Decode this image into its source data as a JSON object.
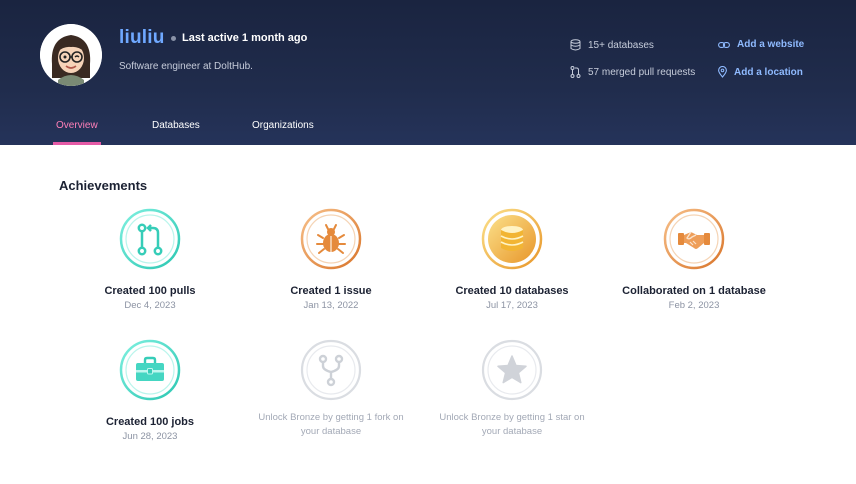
{
  "profile": {
    "username": "liuliu",
    "last_active": "Last active 1 month ago",
    "bio": "Software engineer at DoltHub."
  },
  "stats": {
    "databases": "15+ databases",
    "pulls": "57 merged pull requests",
    "website": "Add a website",
    "location": "Add a location"
  },
  "tabs": [
    "Overview",
    "Databases",
    "Organizations"
  ],
  "achievements_title": "Achievements",
  "achievements": [
    {
      "title": "Created 100 pulls",
      "date": "Dec 4, 2023"
    },
    {
      "title": "Created 1 issue",
      "date": "Jan 13, 2022"
    },
    {
      "title": "Created 10 databases",
      "date": "Jul 17, 2023"
    },
    {
      "title": "Collaborated on 1 database",
      "date": "Feb 2, 2023"
    },
    {
      "title": "Created 100 jobs",
      "date": "Jun 28, 2023"
    },
    {
      "locked_text": "Unlock Bronze by getting 1 fork on your database"
    },
    {
      "locked_text": "Unlock Bronze by getting 1 star on your database"
    }
  ],
  "colors": {
    "header_bg": "#1f2a4a",
    "username": "#6fa8ff",
    "link": "#8fbaff",
    "tab_active": "#ff7fb8",
    "tab_underline": "#e45aa6",
    "teal_badge": "#3ed3c0",
    "orange_badge": "#e58a3c",
    "gold_badge": "#f2b533",
    "locked_badge": "#d4d7dd"
  },
  "icons": {
    "pulls": "pull-request-icon",
    "issue": "bug-icon",
    "databases": "database-icon",
    "collab": "handshake-icon",
    "jobs": "toolbox-icon",
    "fork": "fork-icon",
    "star": "star-icon"
  }
}
